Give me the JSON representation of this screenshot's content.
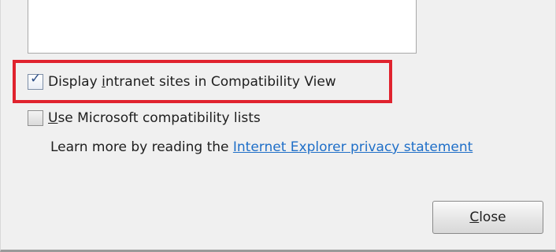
{
  "options": {
    "compatibility_view": {
      "label_pre": "Display ",
      "label_key": "i",
      "label_post": "ntranet sites in Compatibility View",
      "checked": true
    },
    "microsoft_lists": {
      "label_key": "U",
      "label_post": "se Microsoft compatibility lists",
      "checked": false
    }
  },
  "learn_more": {
    "text": "Learn more by reading the ",
    "link_text": "Internet Explorer privacy statement"
  },
  "close_button": {
    "label_key": "C",
    "label_post": "lose"
  },
  "colors": {
    "highlight": "#e0232e",
    "link": "#1f6fc8",
    "background": "#f0f0f0"
  },
  "icons": {
    "checkmark": "check-icon"
  }
}
